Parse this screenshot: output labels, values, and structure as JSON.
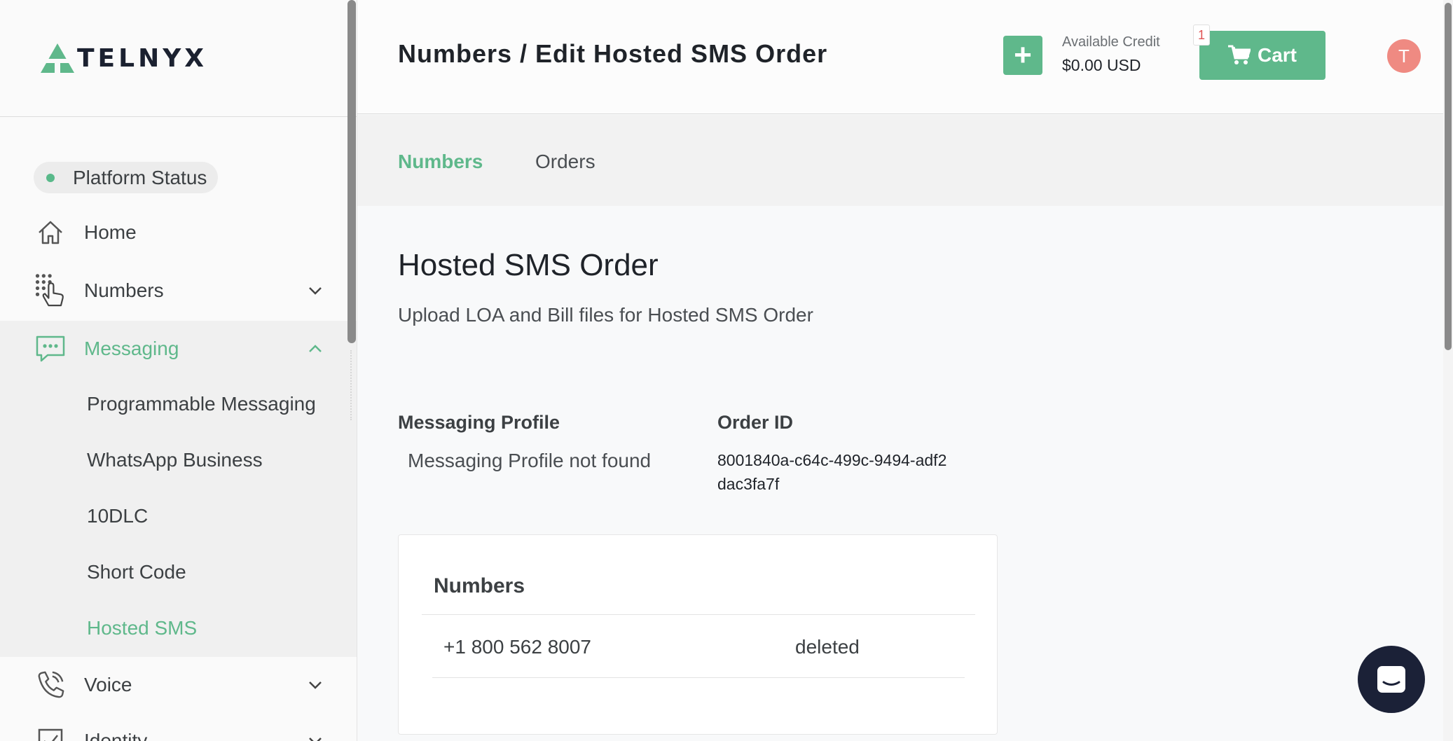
{
  "brand": {
    "name": "TELNYX",
    "accent": "#5fb88b"
  },
  "sidebar": {
    "platform_status": "Platform Status",
    "items": [
      {
        "label": "Home",
        "icon": "home-icon"
      },
      {
        "label": "Numbers",
        "icon": "dialpad-hand-icon"
      },
      {
        "label": "Messaging",
        "icon": "chat-bubble-icon"
      },
      {
        "label": "Voice",
        "icon": "phone-icon"
      },
      {
        "label": "Identity",
        "icon": "checkbox-icon"
      }
    ],
    "messaging_sub": [
      {
        "label": "Programmable Messaging"
      },
      {
        "label": "WhatsApp Business"
      },
      {
        "label": "10DLC"
      },
      {
        "label": "Short Code"
      },
      {
        "label": "Hosted SMS"
      }
    ]
  },
  "header": {
    "breadcrumb": "Numbers / Edit Hosted SMS Order",
    "add_label": "+",
    "credit_label": "Available Credit",
    "credit_value": "$0.00 USD",
    "cart_label": "Cart",
    "cart_count": "1",
    "avatar_initial": "T"
  },
  "tabs": [
    {
      "label": "Numbers",
      "active": true
    },
    {
      "label": "Orders",
      "active": false
    }
  ],
  "main": {
    "title": "Hosted SMS Order",
    "subtitle": "Upload LOA and Bill files for Hosted SMS Order",
    "messaging_profile_label": "Messaging Profile",
    "messaging_profile_value": "Messaging Profile not found",
    "order_id_label": "Order ID",
    "order_id_value": "8001840a-c64c-499c-9494-adf2dac3fa7f",
    "numbers_card": {
      "title": "Numbers",
      "rows": [
        {
          "number": "+1 800 562 8007",
          "status": "deleted"
        }
      ]
    }
  }
}
